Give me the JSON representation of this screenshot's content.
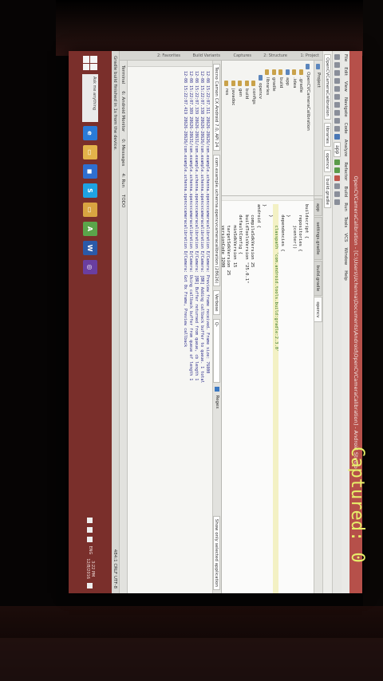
{
  "window": {
    "title": "OpenCVCameraCalibration - [C:\\Users\\Uchenna\\Documents\\Android\\OpenCVCameraCalibration] - Android Studio"
  },
  "menu": [
    "File",
    "Edit",
    "View",
    "Navigate",
    "Code",
    "Analyze",
    "Refactor",
    "Build",
    "Run",
    "Tools",
    "VCS",
    "Window",
    "Help"
  ],
  "navbar": {
    "crumbs": [
      "OpenCVCameraCalibration",
      "libraries",
      "opencv",
      "build.gradle"
    ],
    "run_config": "app"
  },
  "project_panel": {
    "header": "Project",
    "tree": [
      {
        "label": "OpenCVCameraCalibration",
        "kind": "folder-blue",
        "indent": 0
      },
      {
        "label": ".gradle",
        "kind": "folder",
        "indent": 1
      },
      {
        "label": ".idea",
        "kind": "folder",
        "indent": 1
      },
      {
        "label": "app",
        "kind": "folder-blue",
        "indent": 1
      },
      {
        "label": "build",
        "kind": "folder",
        "indent": 1
      },
      {
        "label": "gradle",
        "kind": "folder",
        "indent": 1
      },
      {
        "label": "libraries",
        "kind": "folder",
        "indent": 1
      },
      {
        "label": "opencv",
        "kind": "folder-blue",
        "indent": 2
      },
      {
        "label": "configs",
        "kind": "folder",
        "indent": 3
      },
      {
        "label": "build",
        "kind": "folder",
        "indent": 3
      },
      {
        "label": "gen",
        "kind": "folder",
        "indent": 3
      },
      {
        "label": "javadoc",
        "kind": "folder",
        "indent": 3
      },
      {
        "label": "res",
        "kind": "folder",
        "indent": 3
      },
      {
        "label": "src",
        "kind": "folder",
        "indent": 3
      },
      {
        "label": "lint.xml",
        "kind": "file",
        "indent": 3
      },
      {
        "label": "project.properties",
        "kind": "file",
        "indent": 3
      },
      {
        "label": "AndroidManifest.xml",
        "kind": "file",
        "indent": 3
      },
      {
        "label": "External Libraries",
        "kind": "folder",
        "indent": 0
      }
    ]
  },
  "editor": {
    "tabs": [
      {
        "label": "app",
        "active": false
      },
      {
        "label": "settings.gradle",
        "active": false
      },
      {
        "label": "build.gradle",
        "active": false
      },
      {
        "label": "opencv",
        "active": true
      }
    ],
    "code_lines": [
      "buildscript {",
      "    repositories {",
      "        jcenter()",
      "    }",
      "    dependencies {",
      "        classpath 'com.android.tools.build:gradle:2.3.0'",
      "    }",
      "}",
      "",
      "android {",
      "    compileSdkVersion 25",
      "    buildToolsVersion \"25.0.1\"",
      "",
      "    defaultConfig {",
      "        minSdkVersion 15",
      "        targetSdkVersion 25",
      "        versionCode 3200",
      "        versionName \"3.2.0\"",
      "    }",
      "",
      "    sourceSets {",
      "        main {"
    ]
  },
  "logcat": {
    "device": "Tecno Camon CX Android 7.0, API 24",
    "process": "com.example.uchenna.opencvcameracalibration (28626)",
    "level": "Verbose",
    "search_placeholder": "Q-",
    "regex_label": "Regex",
    "filter_label": "Show only selected application",
    "lines": [
      "12-08 15:22:07.311 28626-28626/com.example.uchenna.opencvcameracalibration E/Camera: Preview frame received. Frame size: 76800",
      "12-08 15:22:07.338 28626-28626/com.example.uchenna.opencvcameracalibration E/Camera: [BR] Adding callback buffer to queue. 1 total",
      "12-08 15:22:07.339 28626-28631/com.example.uchenna.opencvcameracalibration E/Camera: [BR] Buffer returned from queue, cb length 1",
      "12-08 15:22:07.389 28626-28631/com.example.uchenna.opencvcameracalibration D/Camera: Using callback buffer from queue of length 1",
      "12-08 15:22:07.419 28626-28626/com.example.uchenna.opencvcameracalibration D/Camera: Got 0x Frame, Preview callback"
    ]
  },
  "bottom_tabs": [
    "Terminal",
    "6: Android Monitor",
    "0: Messages",
    "4: Run",
    "TODO"
  ],
  "status": {
    "left": "Gradle build finished in 1s from the device.",
    "right": "484:1  CRLF  UTF-8"
  },
  "left_strip": [
    "1: Project",
    "2: Structure",
    "Captures",
    "Build Variants",
    "2: Favorites"
  ],
  "taskbar": {
    "search_placeholder": "Ask me anything",
    "apps": [
      {
        "name": "edge-icon",
        "glyph": "e",
        "color": "#2a7bd8"
      },
      {
        "name": "file-explorer-icon",
        "glyph": "▭",
        "color": "#e3b34a"
      },
      {
        "name": "store-icon",
        "glyph": "◼",
        "color": "#2f6fd0"
      },
      {
        "name": "skype-icon",
        "glyph": "S",
        "color": "#1ea3e2"
      },
      {
        "name": "folder-icon",
        "glyph": "▭",
        "color": "#d9a441"
      },
      {
        "name": "android-studio-icon",
        "glyph": "A",
        "color": "#5ba54a"
      },
      {
        "name": "word-icon",
        "glyph": "W",
        "color": "#2b5aa8"
      },
      {
        "name": "github-icon",
        "glyph": "◎",
        "color": "#6a3ea0"
      }
    ],
    "lang": "ENG",
    "time": "3:22 PM",
    "date": "12/8/2016"
  },
  "watermark": "Captured: 0"
}
